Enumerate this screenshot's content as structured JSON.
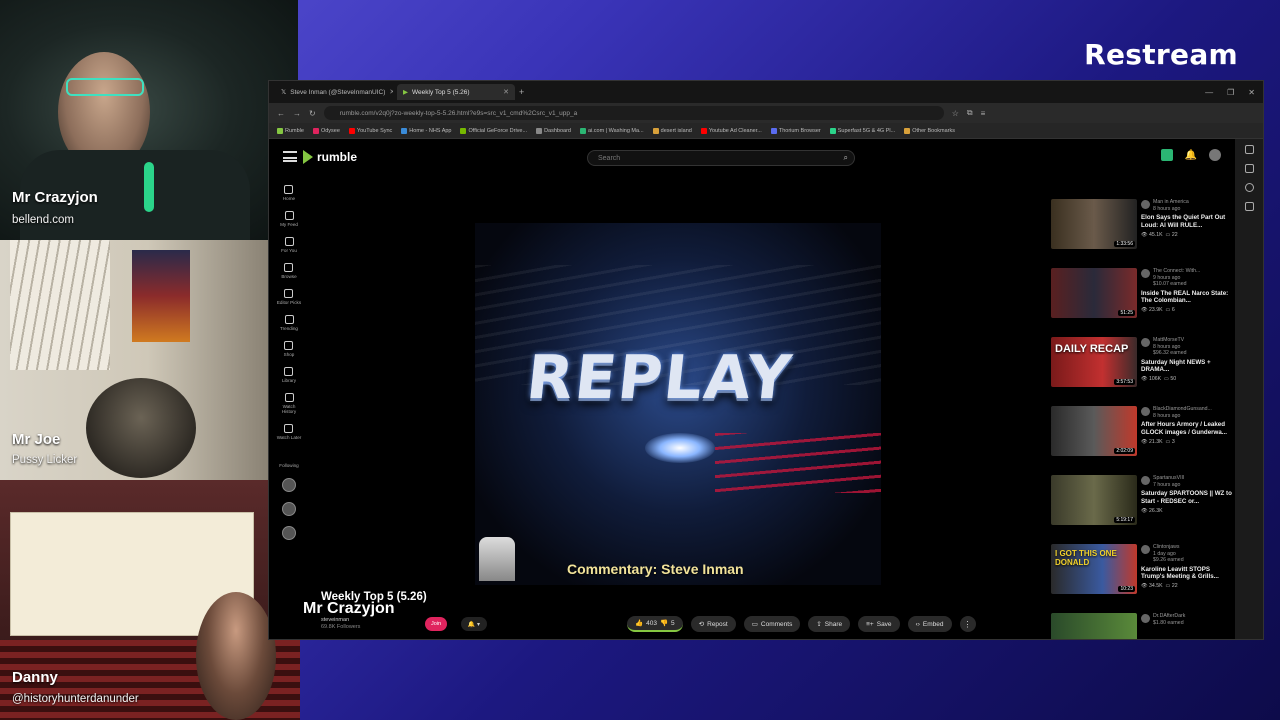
{
  "brand": "Restream",
  "cams": [
    {
      "name": "Mr Crazyjon",
      "sub": "bellend.com"
    },
    {
      "name": "Mr Joe",
      "sub": "Pussy Licker"
    },
    {
      "name": "Danny",
      "sub": "@historyhunterdanunder"
    }
  ],
  "browser": {
    "tabs": [
      {
        "label": "Steve Inman (@SteveInmanUIC)"
      },
      {
        "label": "Weekly Top 5 (5.26)"
      }
    ],
    "url": "rumble.com/v2q0j?zo-weekly-top-5-5.26.html?e9s=src_v1_cmd%2Csrc_v1_upp_a",
    "bookmarks": [
      "Rumble",
      "Odysee",
      "YouTube Sync",
      "Home - NHS App",
      "Official GeForce Drive...",
      "Dashboard",
      "ai.com | Washing Ma...",
      "desert island",
      "Youtube Ad Cleaner...",
      "Thorium Browser",
      "Superfast 5G & 4G Pl...",
      "Other Bookmarks"
    ]
  },
  "rumble": {
    "logo": "rumble",
    "search_placeholder": "Search",
    "sidebar": [
      "Home",
      "My Feed",
      "For You",
      "Browse",
      "Editor Picks",
      "Trending",
      "Shop",
      "Library",
      "Watch History",
      "Watch Later"
    ],
    "following_label": "Following"
  },
  "video": {
    "banner": "REPLAY",
    "caption": "Commentary: Steve Inman",
    "title": "Weekly Top 5 (5.26)",
    "overlay_name": "Mr Crazyjon",
    "channel": "steveinman",
    "followers": "69.8K Followers",
    "join": "Join",
    "likes": "403",
    "dislikes": "5",
    "actions": [
      "Repost",
      "Comments",
      "Share",
      "Save",
      "Embed"
    ]
  },
  "related": [
    {
      "channel": "Man in America",
      "age": "8 hours ago",
      "title": "Elon Says the Quiet Part Out Loud: AI Will RULE...",
      "views": "45.1K",
      "comments": "22",
      "duration": "1:33:56",
      "overlay": ""
    },
    {
      "channel": "The Connect: With...",
      "age": "9 hours ago",
      "title": "Inside The REAL Narco State: The Colombian...",
      "views": "23.9K",
      "comments": "6",
      "duration": "51:25",
      "earned": "$10.07 earned",
      "overlay": ""
    },
    {
      "channel": "MattMorseTV",
      "age": "8 hours ago",
      "title": "Saturday Night NEWS + DRAMA...",
      "views": "106K",
      "comments": "50",
      "duration": "3:57:53",
      "earned": "$96.32 earned",
      "overlay": "DAILY RECAP"
    },
    {
      "channel": "BlackDiamondGunsand...",
      "age": "8 hours ago",
      "title": "After Hours Armory / Leaked GLOCK images / Gunderwa...",
      "views": "21.3K",
      "comments": "3",
      "duration": "2:02:09",
      "overlay": ""
    },
    {
      "channel": "SpartanusVIII",
      "age": "7 hours ago",
      "title": "Saturday SPARTOONS || WZ to Start - REDSEC or...",
      "views": "26.3K",
      "comments": "",
      "duration": "5:19:17",
      "overlay": ""
    },
    {
      "channel": "Clintonjaws",
      "age": "1 day ago",
      "title": "Karoline Leavitt STOPS Trump's Meeting & Grills...",
      "views": "34.5K",
      "comments": "22",
      "duration": "10:23",
      "earned": "$9.26 earned",
      "overlay": "I GOT THIS ONE DONALD"
    },
    {
      "channel": "Dr.DAfterDark",
      "age": "",
      "title": "",
      "views": "",
      "comments": "",
      "duration": "",
      "earned": "$1.80 earned",
      "overlay": ""
    }
  ],
  "colors": {
    "accent": "#85c742",
    "join": "#e0245e",
    "stage": "#3a34b8"
  }
}
